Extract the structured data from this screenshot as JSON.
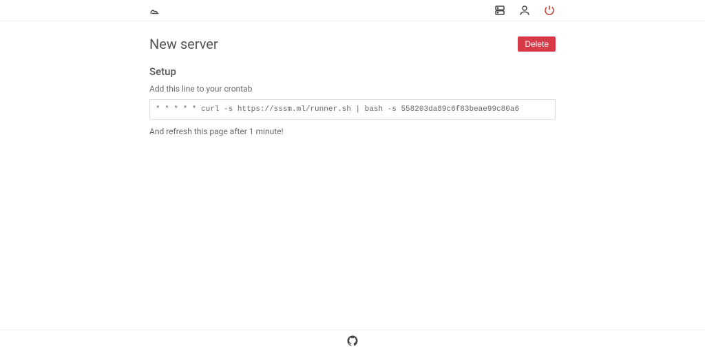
{
  "nav": {
    "logo": "terminal-logo",
    "right": [
      "server",
      "user",
      "power"
    ]
  },
  "page": {
    "title": "New server",
    "delete_label": "Delete",
    "section_title": "Setup",
    "instruction": "Add this line to your crontab",
    "command": "* * * * * curl -s https://sssm.ml/runner.sh | bash -s 558203da89c6f83beae99c80a6",
    "refresh_note": "And refresh this page after 1 minute!"
  },
  "footer": {
    "link": "github"
  }
}
